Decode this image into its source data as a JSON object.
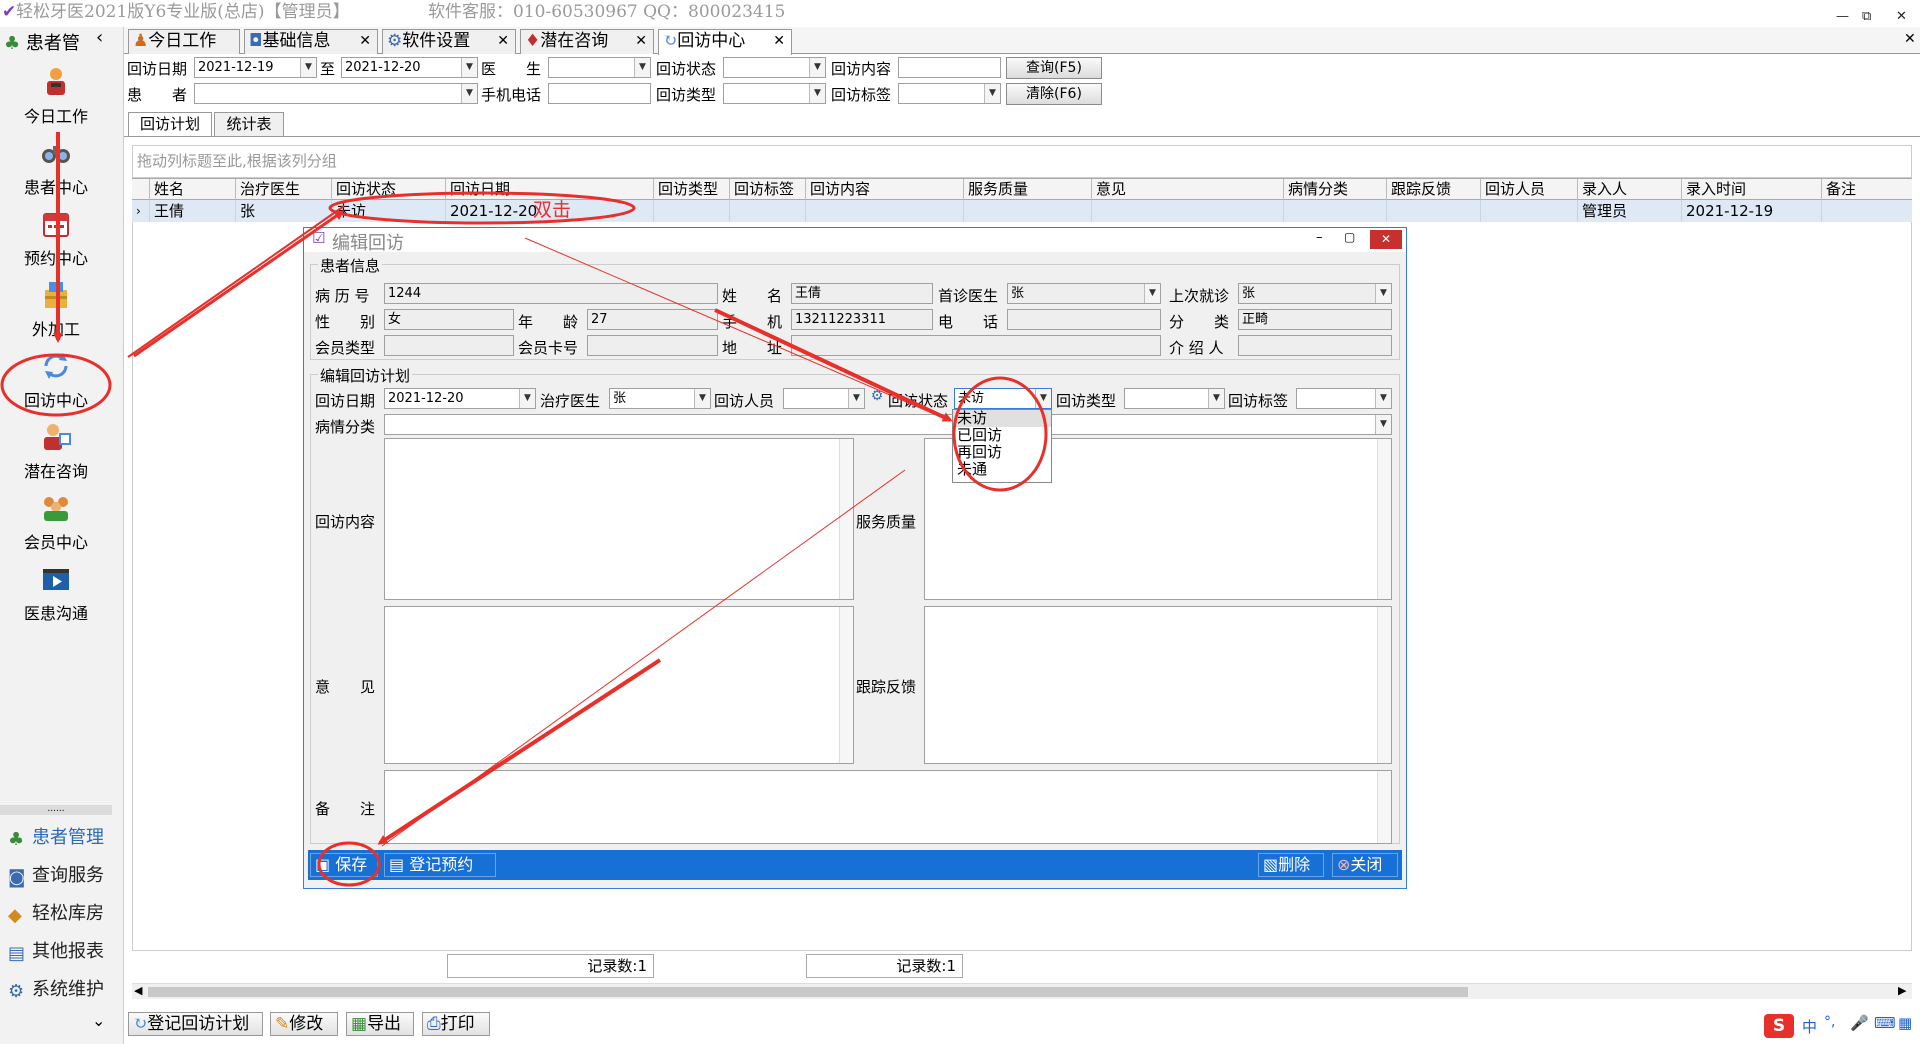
{
  "app": {
    "title": "轻松牙医2021版Y6专业版(总店)【管理员】",
    "support": "软件客服：010-60530967  QQ：800023415",
    "window_controls": [
      "—",
      "⧉",
      "✕"
    ]
  },
  "sidebar": {
    "header": "患者管",
    "collapse_symbol": "‹",
    "items": [
      {
        "label": "今日工作",
        "icon": "worker-icon"
      },
      {
        "label": "患者中心",
        "icon": "binoculars-icon"
      },
      {
        "label": "预约中心",
        "icon": "calendar-icon"
      },
      {
        "label": "外加工",
        "icon": "box-icon"
      },
      {
        "label": "回访中心",
        "icon": "refresh-icon"
      },
      {
        "label": "潜在咨询",
        "icon": "consult-icon"
      },
      {
        "label": "会员中心",
        "icon": "members-icon"
      },
      {
        "label": "医患沟通",
        "icon": "video-icon"
      }
    ],
    "divider": "......",
    "menu": [
      {
        "label": "患者管理",
        "icon": "users-icon"
      },
      {
        "label": "查询服务",
        "icon": "query-icon"
      },
      {
        "label": "轻松库房",
        "icon": "warehouse-icon"
      },
      {
        "label": "其他报表",
        "icon": "report-icon"
      },
      {
        "label": "系统维护",
        "icon": "settings-icon"
      }
    ],
    "more": "⌄"
  },
  "tabs": [
    {
      "label": "今日工作",
      "closable": false
    },
    {
      "label": "基础信息",
      "closable": true
    },
    {
      "label": "软件设置",
      "closable": true
    },
    {
      "label": "潜在咨询",
      "closable": true
    },
    {
      "label": "回访中心",
      "closable": true
    }
  ],
  "tabs_close_all": "✕",
  "filters": {
    "date_label": "回访日期",
    "date_from": "2021-12-19",
    "to_label": "至",
    "date_to": "2021-12-20",
    "doctor_label": "医　　生",
    "doctor_value": "",
    "status_label": "回访状态",
    "status_value": "",
    "content_label": "回访内容",
    "content_value": "",
    "patient_label": "患　　者",
    "patient_value": "",
    "phone_label": "手机电话",
    "phone_value": "",
    "type_label": "回访类型",
    "type_value": "",
    "tag_label": "回访标签",
    "tag_value": "",
    "query_button": "查询(F5)",
    "clear_button": "清除(F6)"
  },
  "subtabs": [
    "回访计划",
    "统计表"
  ],
  "grid": {
    "group_hint": "拖动列标题至此,根据该列分组",
    "columns": [
      "姓名",
      "治疗医生",
      "回访状态",
      "回访日期",
      "回访类型",
      "回访标签",
      "回访内容",
      "服务质量",
      "意见",
      "病情分类",
      "跟踪反馈",
      "回访人员",
      "录入人",
      "录入时间",
      "备注"
    ],
    "rows": [
      {
        "marker": "›",
        "cells": [
          "王倩",
          "张",
          "未访",
          "2021-12-20",
          "",
          "",
          "",
          "",
          "",
          "",
          "",
          "",
          "管理员",
          "2021-12-19",
          ""
        ]
      }
    ]
  },
  "dialog": {
    "title": "编辑回访",
    "controls": [
      "–",
      "▢",
      "✕"
    ],
    "patient_section": "患者信息",
    "record_no_label": "病 历 号",
    "record_no": "1244",
    "name_label": "姓　　名",
    "name": "王倩",
    "first_doctor_label": "首诊医生",
    "first_doctor": "张",
    "last_visit_label": "上次就诊",
    "last_visit": "张",
    "gender_label": "性　　别",
    "gender": "女",
    "age_label": "年　　龄",
    "age": "27",
    "mobile_label": "手　　机",
    "mobile": "13211223311",
    "tel_label": "电　　话",
    "tel": "",
    "category_label": "分　　类",
    "category": "正畸",
    "member_type_label": "会员类型",
    "member_type": "",
    "member_card_label": "会员卡号",
    "member_card": "",
    "address_label": "地　　址",
    "address": "",
    "referrer_label": "介 绍 人",
    "referrer": "",
    "plan_section": "编辑回访计划",
    "plan_date_label": "回访日期",
    "plan_date": "2021-12-20",
    "plan_doctor_label": "治疗医生",
    "plan_doctor": "张",
    "staff_label": "回访人员",
    "staff": "",
    "plan_status_label": "回访状态",
    "plan_status": "未访",
    "plan_type_label": "回访类型",
    "plan_type": "",
    "plan_tag_label": "回访标签",
    "plan_tag": "",
    "condition_label": "病情分类",
    "condition": "",
    "content_label": "回访内容",
    "quality_label": "服务质量",
    "opinion_label": "意　　见",
    "feedback_label": "跟踪反馈",
    "remark_label": "备　　注",
    "save_button": "保存",
    "appointment_button": "登记预约",
    "delete_button": "删除",
    "close_button": "关闭"
  },
  "status_dropdown": {
    "options": [
      "未访",
      "已回访",
      "再回访",
      "未通"
    ],
    "selected": "未访"
  },
  "footer": {
    "count1": "记录数:1",
    "count2": "记录数:1"
  },
  "toolbar": [
    "登记回访计划",
    "修改",
    "导出",
    "打印"
  ],
  "annotation": {
    "double_click": "双击",
    "color": "#e8302b"
  },
  "tray": {
    "ime": "中"
  }
}
